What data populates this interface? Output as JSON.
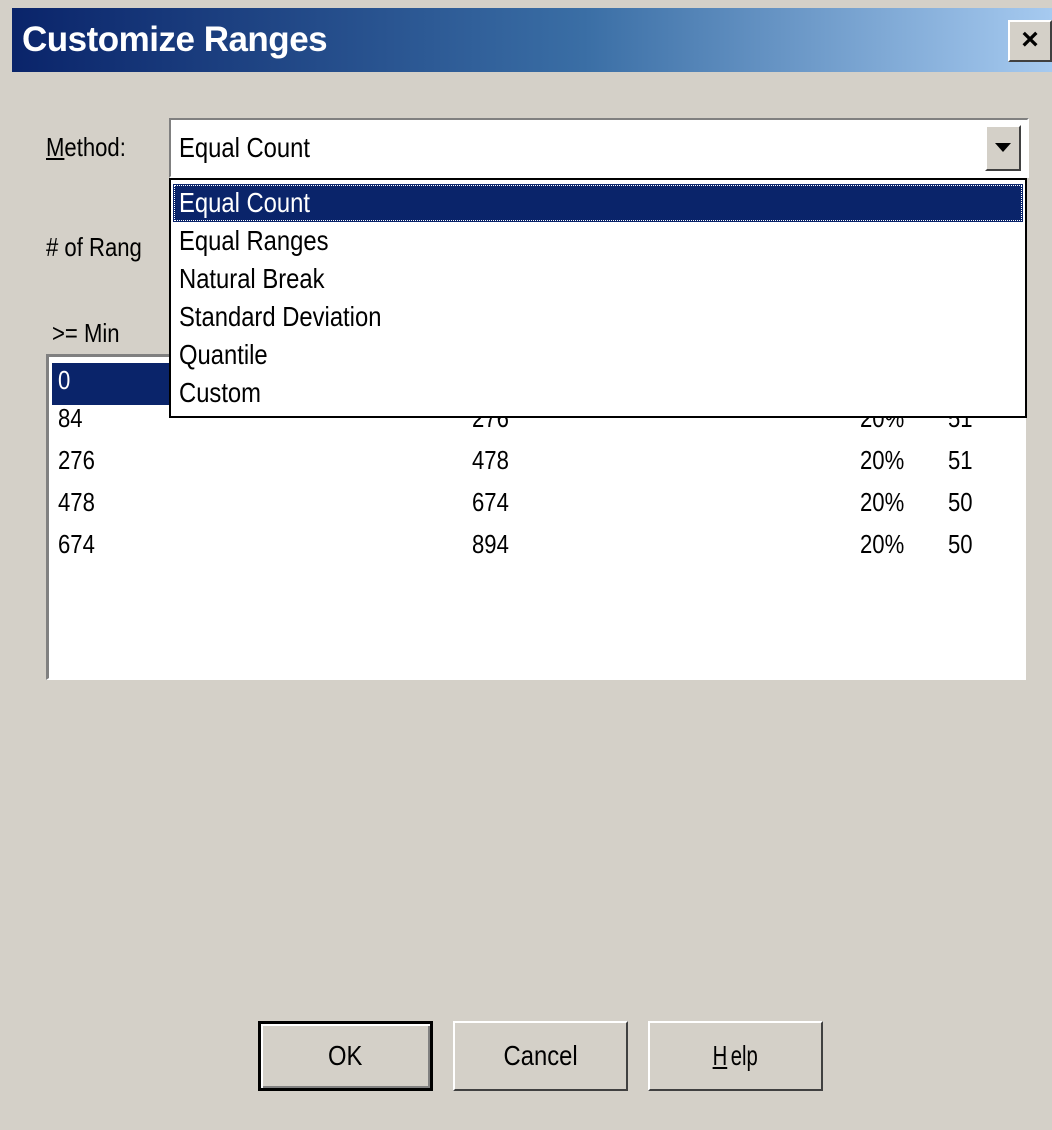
{
  "window": {
    "title": "Customize Ranges",
    "close_label": "×"
  },
  "method": {
    "label_mnemonic": "M",
    "label_rest": "ethod:",
    "value": "Equal Count",
    "options": [
      "Equal Count",
      "Equal Ranges",
      "Natural Break",
      "Standard Deviation",
      "Quantile",
      "Custom"
    ],
    "highlighted_option": "Equal Count"
  },
  "ranges": {
    "label_visible": "# of Rang",
    "min_header": ">= Min",
    "rows": [
      {
        "min": "0",
        "max": "",
        "pct": "",
        "count": ""
      },
      {
        "min": "84",
        "max": "276",
        "pct": "20%",
        "count": "51"
      },
      {
        "min": "276",
        "max": "478",
        "pct": "20%",
        "count": "51"
      },
      {
        "min": "478",
        "max": "674",
        "pct": "20%",
        "count": "50"
      },
      {
        "min": "674",
        "max": "894",
        "pct": "20%",
        "count": "50"
      }
    ],
    "selected_row": 0
  },
  "buttons": {
    "ok": "OK",
    "cancel": "Cancel",
    "help_mnemonic": "H",
    "help_rest": "elp"
  },
  "colors": {
    "title_bar_start": "#0a246a",
    "title_bar_end": "#a6caf0",
    "selection": "#0a246a",
    "dialog_face": "#d4d0c8"
  }
}
